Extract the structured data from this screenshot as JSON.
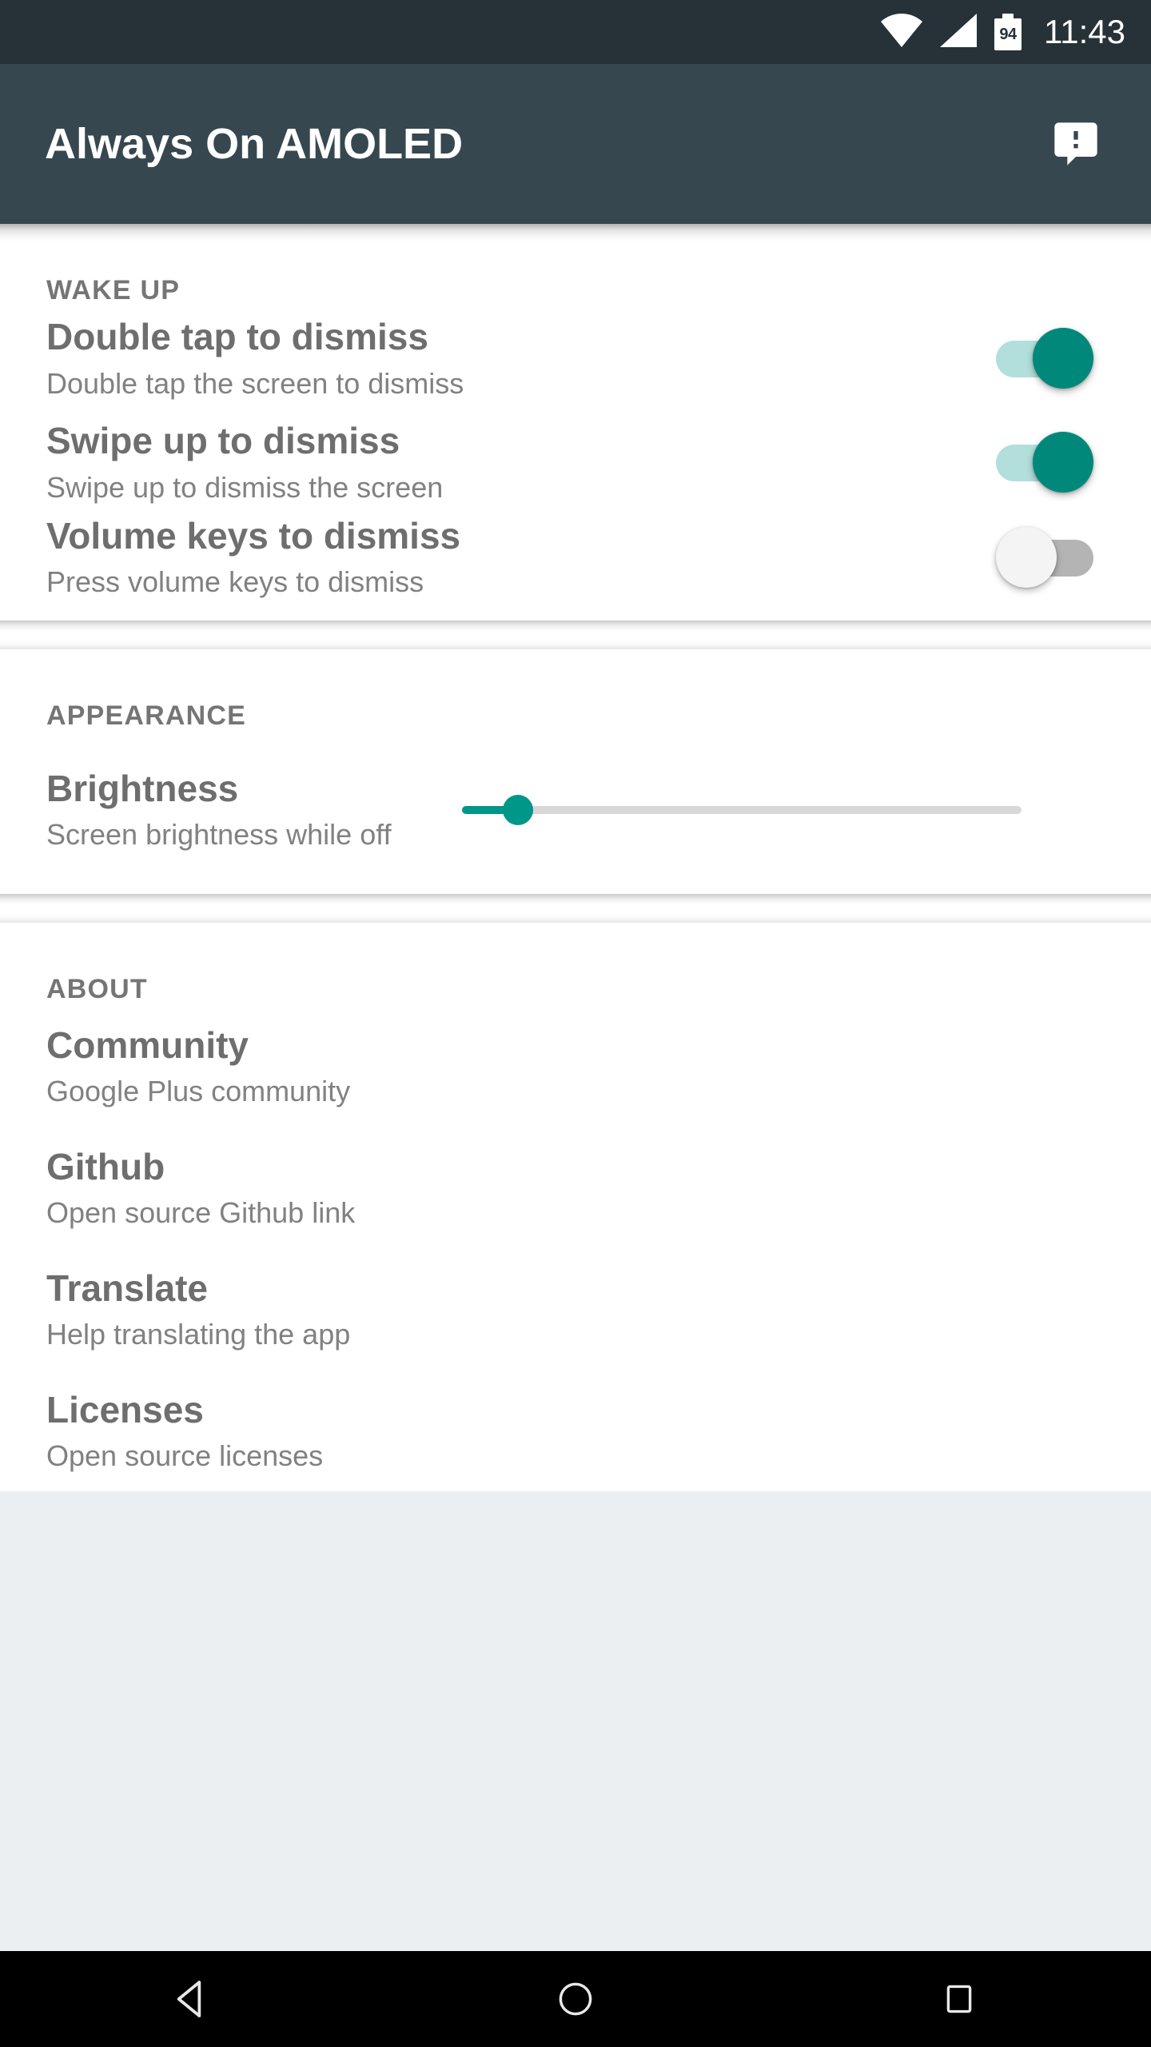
{
  "status_bar": {
    "background": "#263238",
    "time": "11:43",
    "battery_level": "94",
    "icons": [
      "wifi-icon",
      "cellular-signal-icon",
      "battery-icon"
    ]
  },
  "app_bar": {
    "background": "#37474F",
    "title": "Always On AMOLED",
    "action_icon": "feedback-icon"
  },
  "sections": [
    {
      "header": "WAKE UP",
      "rows": [
        {
          "title": "Double tap to dismiss",
          "subtitle": "Double tap the screen to dismiss",
          "control": "switch",
          "checked": true
        },
        {
          "title": "Swipe up to dismiss",
          "subtitle": "Swipe up to dismiss the screen",
          "control": "switch",
          "checked": true
        },
        {
          "title": "Volume keys to dismiss",
          "subtitle": "Press volume keys to dismiss",
          "control": "switch",
          "checked": false
        }
      ]
    },
    {
      "header": "APPEARANCE",
      "rows": [
        {
          "title": "Brightness",
          "subtitle": "Screen brightness while off",
          "control": "slider",
          "value_percent": 10
        }
      ]
    },
    {
      "header": "ABOUT",
      "rows": [
        {
          "title": "Community",
          "subtitle": "Google Plus community",
          "control": "none"
        },
        {
          "title": "Github",
          "subtitle": "Open source Github link",
          "control": "none"
        },
        {
          "title": "Translate",
          "subtitle": "Help translating the app",
          "control": "none"
        },
        {
          "title": "Licenses",
          "subtitle": "Open source licenses",
          "control": "none"
        }
      ]
    }
  ],
  "nav_bar": {
    "background": "#000000",
    "buttons": [
      "back-icon",
      "home-icon",
      "recents-icon"
    ]
  },
  "colors": {
    "accent": "#009688",
    "switch_on_thumb": "#00897B",
    "switch_on_track": "#B2DFDB",
    "switch_off_thumb": "#F4F4F4",
    "switch_off_track": "#B4B4B4",
    "title_text": "#6E6E6E",
    "subtitle_text": "#818181",
    "section_header_text": "#757575"
  }
}
